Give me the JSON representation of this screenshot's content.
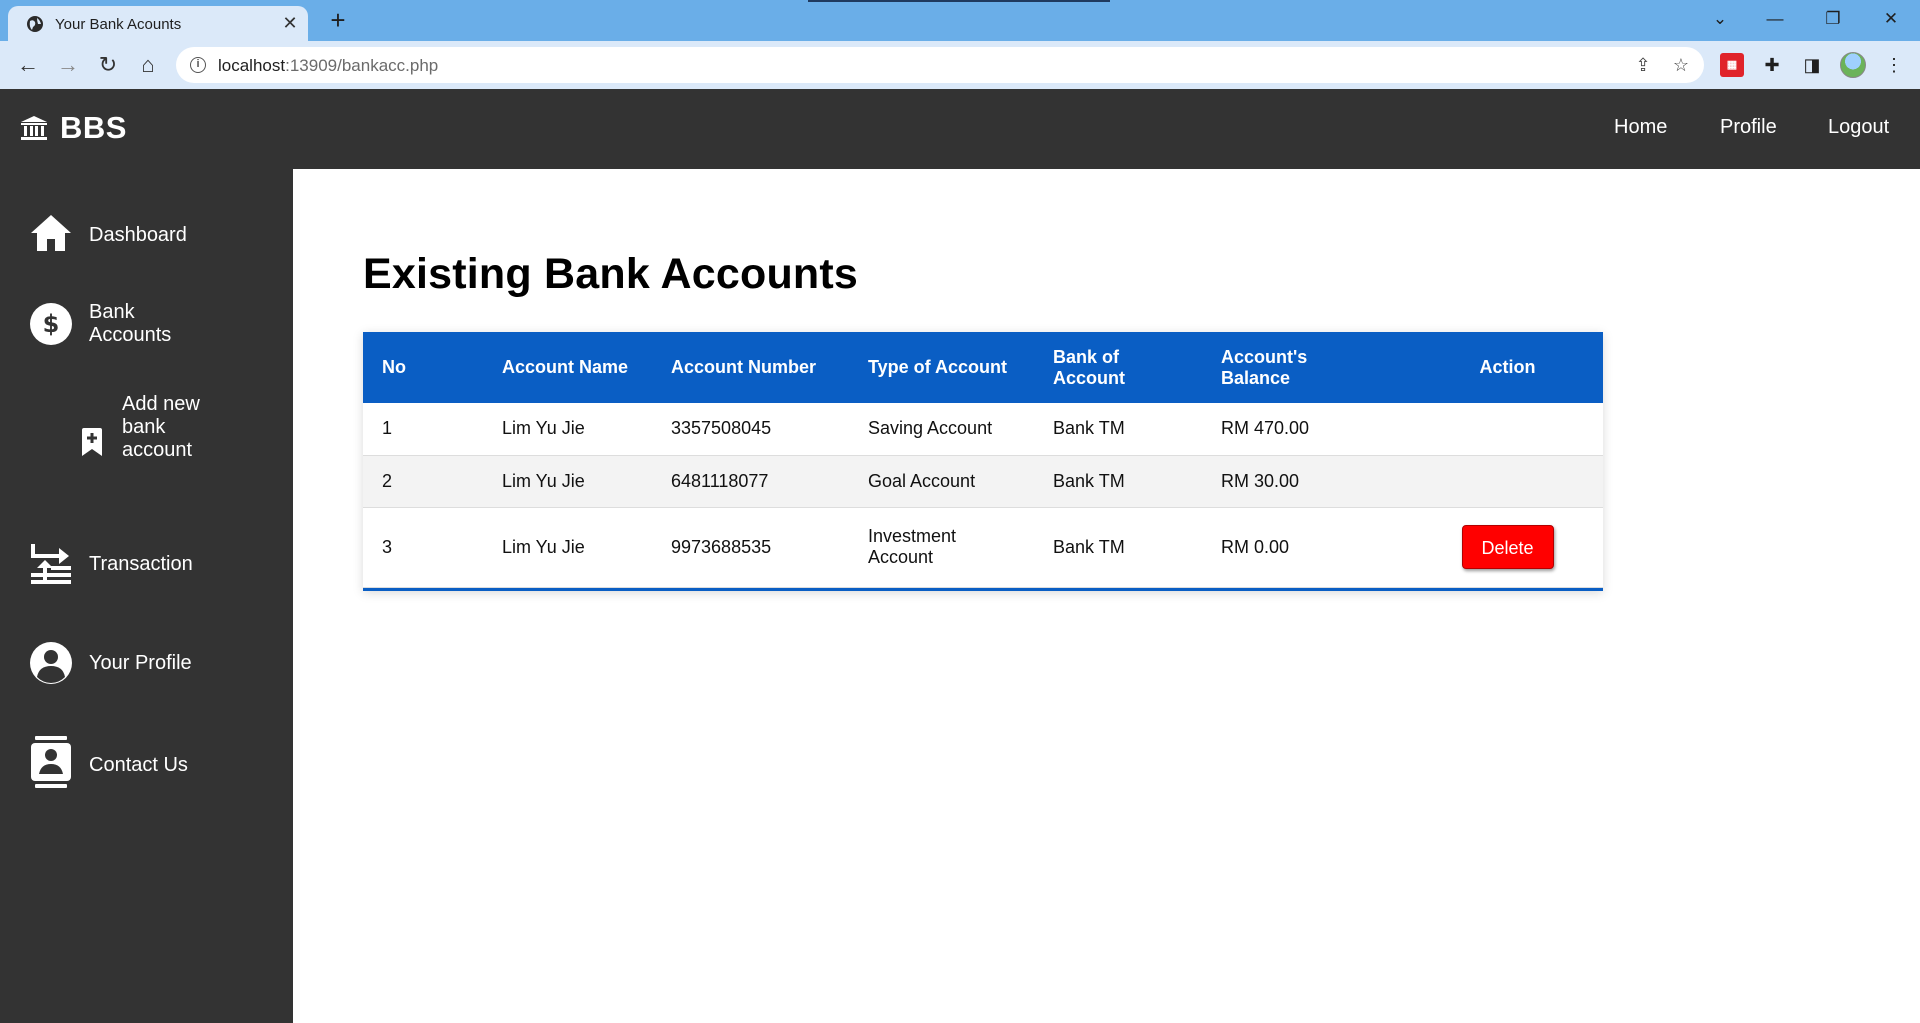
{
  "browser": {
    "tab_title": "Your Bank Acounts",
    "url_host": "localhost",
    "url_path": ":13909/bankacc.php"
  },
  "header": {
    "brand": "BBS",
    "nav": [
      "Home",
      "Profile",
      "Logout"
    ]
  },
  "sidebar": {
    "items": [
      {
        "label": "Dashboard",
        "icon": "home-icon"
      },
      {
        "label": "Bank Accounts",
        "icon": "dollar-circle-icon"
      },
      {
        "label": "Add new bank account",
        "icon": "bookmark-plus-icon"
      },
      {
        "label": "Transaction",
        "icon": "transaction-icon"
      },
      {
        "label": "Your Profile",
        "icon": "user-circle-icon"
      },
      {
        "label": "Contact Us",
        "icon": "contact-card-icon"
      }
    ]
  },
  "main": {
    "title": "Existing Bank Accounts",
    "table": {
      "headers": [
        "No",
        "Account Name",
        "Account Number",
        "Type of Account",
        "Bank of Account",
        "Account's Balance",
        "Action"
      ],
      "rows": [
        {
          "no": "1",
          "name": "Lim Yu Jie",
          "number": "3357508045",
          "type": "Saving Account",
          "bank": "Bank TM",
          "balance": "RM 470.00",
          "action": ""
        },
        {
          "no": "2",
          "name": "Lim Yu Jie",
          "number": "6481118077",
          "type": "Goal Account",
          "bank": "Bank TM",
          "balance": "RM 30.00",
          "action": ""
        },
        {
          "no": "3",
          "name": "Lim Yu Jie",
          "number": "9973688535",
          "type": "Investment Account",
          "bank": "Bank TM",
          "balance": "RM 0.00",
          "action": "Delete"
        }
      ]
    }
  },
  "colors": {
    "header_bg": "#333333",
    "table_header": "#0a5ec4",
    "delete_button": "#ff0000"
  }
}
